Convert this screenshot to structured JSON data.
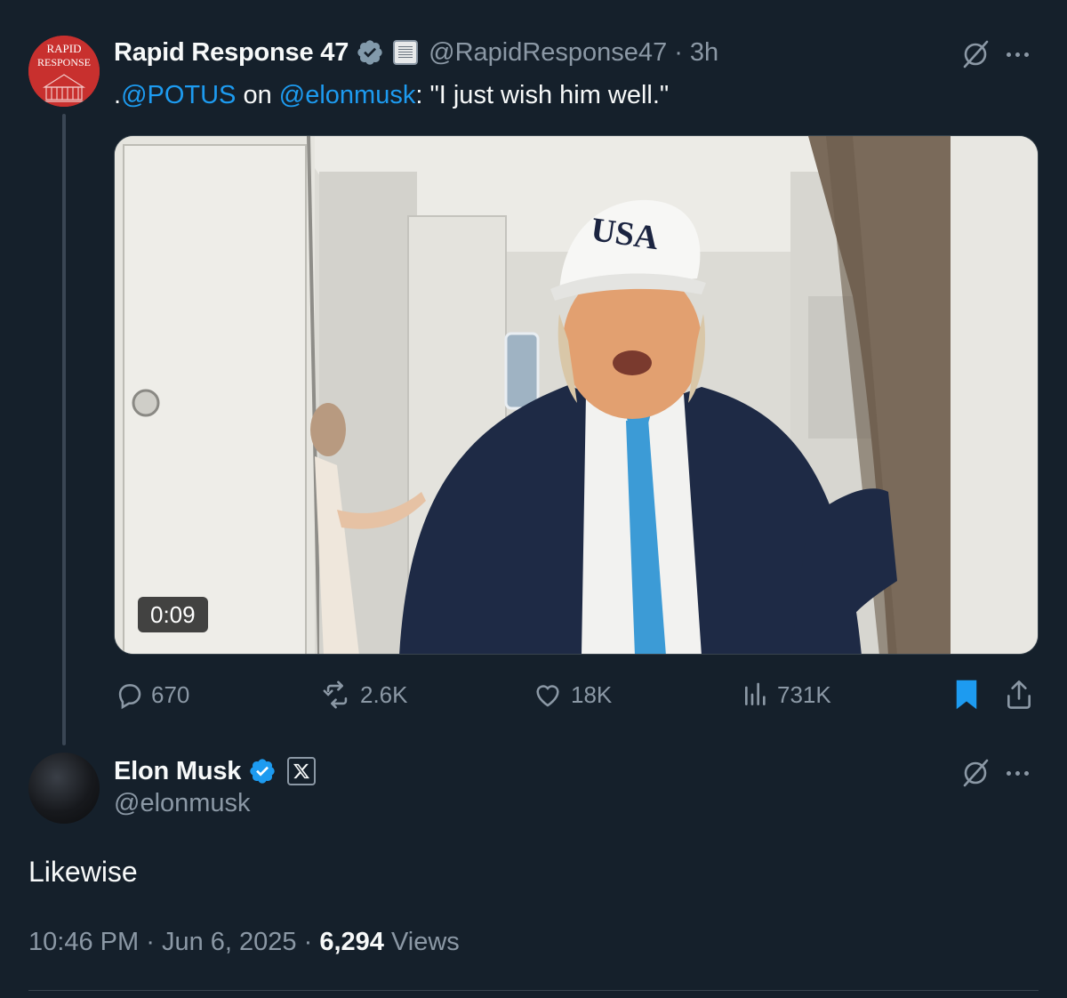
{
  "parent_tweet": {
    "display_name": "Rapid Response 47",
    "handle": "@RapidResponse47",
    "separator": "·",
    "time": "3h",
    "avatar_text_line1": "RAPID",
    "avatar_text_line2": "RESPONSE",
    "text_prefix": ".",
    "mention_1": "@POTUS",
    "text_middle": " on ",
    "mention_2": "@elonmusk",
    "text_suffix": ": \"I just wish him well.\"",
    "video": {
      "duration": "0:09",
      "cap_text": "USA"
    },
    "actions": {
      "replies": "670",
      "reposts": "2.6K",
      "likes": "18K",
      "views": "731K"
    },
    "icons": {
      "verified": "verified-badge-icon",
      "affiliate": "white-house-affiliate-icon",
      "grok": "grok-icon",
      "more": "more-icon",
      "reply": "reply-icon",
      "repost": "repost-icon",
      "like": "like-icon",
      "views": "views-icon",
      "bookmark": "bookmark-icon",
      "share": "share-icon"
    }
  },
  "reply_tweet": {
    "display_name": "Elon Musk",
    "handle": "@elonmusk",
    "text": "Likewise",
    "time": "10:46 PM",
    "date": "Jun 6, 2025",
    "separator": "·",
    "views_count": "6,294",
    "views_label": "Views",
    "icons": {
      "verified": "verified-badge-icon",
      "affiliate": "x-affiliate-icon"
    }
  },
  "colors": {
    "background": "#15202b",
    "text_primary": "#f7f9f9",
    "text_secondary": "#8b98a5",
    "accent": "#1d9bf0",
    "divider": "#38444d"
  }
}
